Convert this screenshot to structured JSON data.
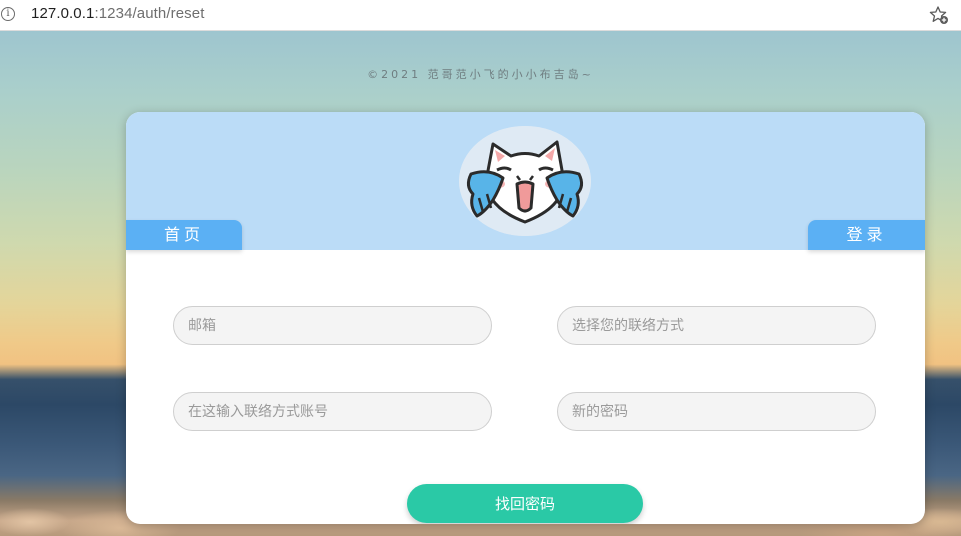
{
  "browser": {
    "url_host": "127.0.0.1",
    "url_rest": ":1234/auth/reset",
    "info_icon": "info-icon",
    "favorite_icon": "star-add-icon"
  },
  "page": {
    "copyright": "©2021 范哥范小飞的小小布吉岛~",
    "avatar": "cat-avatar",
    "nav": {
      "home": "首页",
      "login": "登录"
    },
    "form": {
      "email_placeholder": "邮箱",
      "contact_type_placeholder": "选择您的联络方式",
      "account_placeholder": "在这输入联络方式账号",
      "password_placeholder": "新的密码",
      "submit_label": "找回密码"
    }
  },
  "colors": {
    "header_bg": "#bbdcf7",
    "tab_bg": "#5bb0f4",
    "submit_bg": "#2ac9a6",
    "field_bg": "#f4f4f4"
  }
}
